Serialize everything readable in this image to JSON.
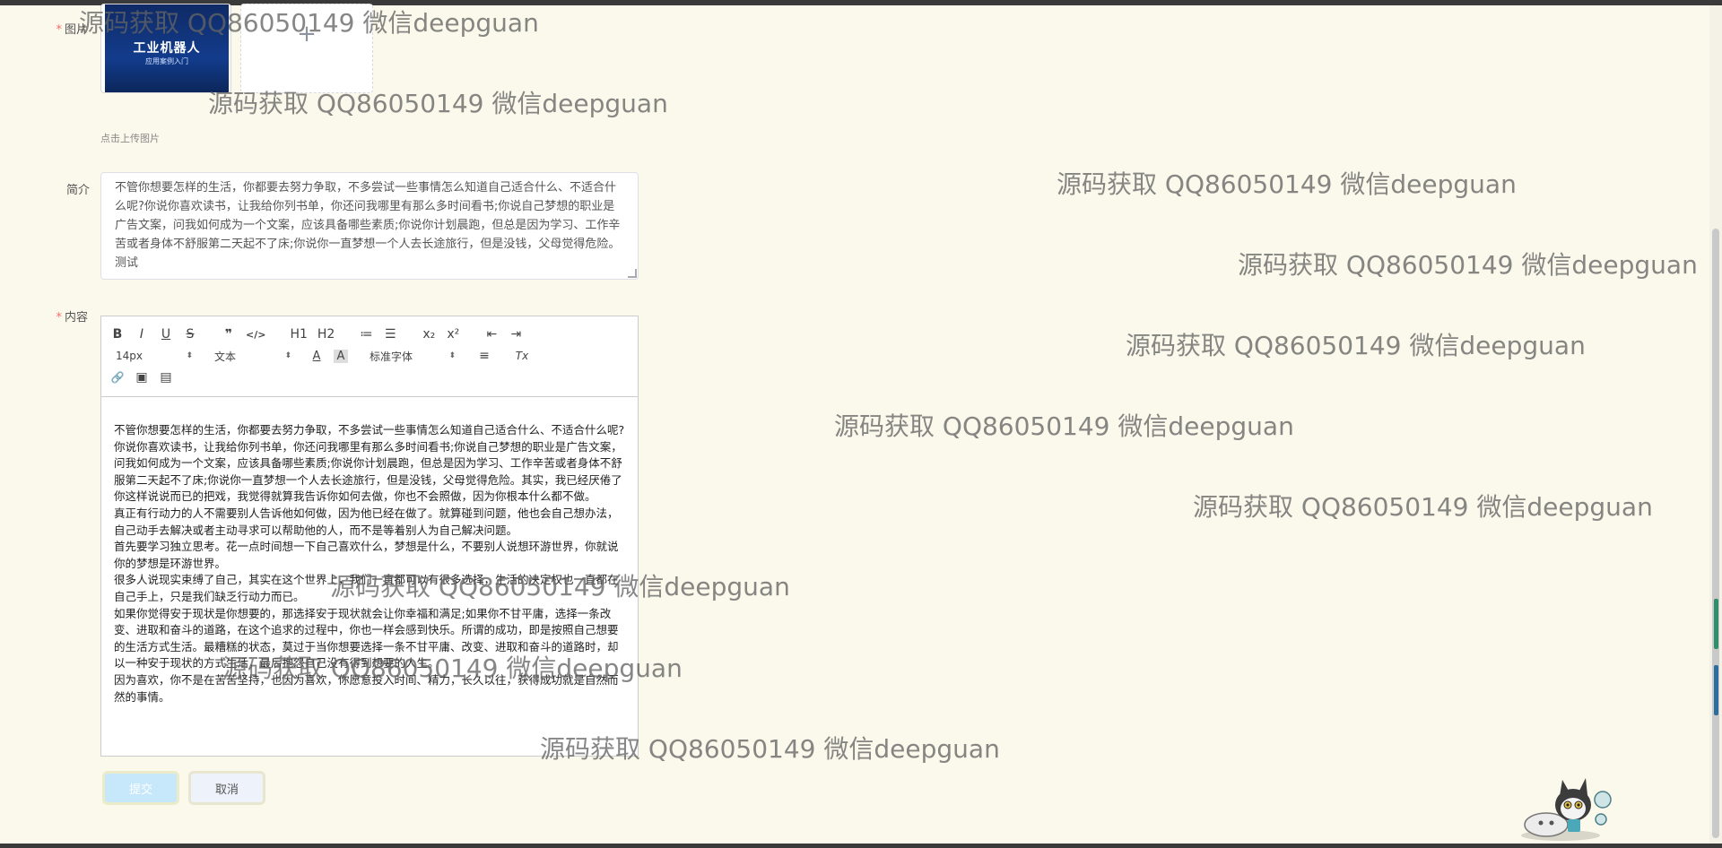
{
  "form": {
    "image_label": "图片",
    "upload_plus": "+",
    "upload_hint": "点击上传图片",
    "book_title": "工业机器人",
    "book_subtitle": "应用案例入门",
    "summary_label": "简介",
    "summary_value": "不管你想要怎样的生活，你都要去努力争取，不多尝试一些事情怎么知道自己适合什么、不适合什么呢?你说你喜欢读书，让我给你列书单，你还问我哪里有那么多时间看书;你说自己梦想的职业是广告文案，问我如何成为一个文案，应该具备哪些素质;你说你计划晨跑，但总是因为学习、工作辛苦或者身体不舒服第二天起不了床;你说你一直梦想一个人去长途旅行，但是没钱，父母觉得危险。测试",
    "content_label": "内容",
    "required_mark": "*",
    "submit_label": "提交",
    "cancel_label": "取消"
  },
  "editor": {
    "toolbar": {
      "bold": "B",
      "italic": "I",
      "underline": "U",
      "strike": "S",
      "blockquote": "❞",
      "code": "</>",
      "h1": "H1",
      "h2": "H2",
      "ordered_list": "≔",
      "bullet_list": "☰",
      "subscript": "x₂",
      "superscript": "x²",
      "outdent": "⇤",
      "indent": "⇥",
      "size": "14px",
      "header": "文本",
      "color": "A",
      "background": "A",
      "font": "标准字体",
      "align": "≡",
      "clean": "Tx",
      "link": "🔗",
      "image": "▣",
      "video": "▤",
      "select_arrow": "⬍"
    },
    "paragraphs": [
      "不管你想要怎样的生活，你都要去努力争取，不多尝试一些事情怎么知道自己适合什么、不适合什么呢?",
      "你说你喜欢读书，让我给你列书单，你还问我哪里有那么多时间看书;你说自己梦想的职业是广告文案，问我如何成为一个文案，应该具备哪些素质;你说你计划晨跑，但总是因为学习、工作辛苦或者身体不舒服第二天起不了床;你说你一直梦想一个人去长途旅行，但是没钱，父母觉得危险。其实，我已经厌倦了你这样说说而已的把戏，我觉得就算我告诉你如何去做，你也不会照做，因为你根本什么都不做。",
      "真正有行动力的人不需要别人告诉他如何做，因为他已经在做了。就算碰到问题，他也会自己想办法，自己动手去解决或者主动寻求可以帮助他的人，而不是等着别人为自己解决问题。",
      "首先要学习独立思考。花一点时间想一下自己喜欢什么，梦想是什么，不要别人说想环游世界，你就说你的梦想是环游世界。",
      "很多人说现实束缚了自己，其实在这个世界上，我们一直都可以有很多选择，生活的决定权也一直都在自己手上，只是我们缺乏行动力而已。",
      "如果你觉得安于现状是你想要的，那选择安于现状就会让你幸福和满足;如果你不甘平庸，选择一条改变、进取和奋斗的道路，在这个追求的过程中，你也一样会感到快乐。所谓的成功，即是按照自己想要的生活方式生活。最糟糕的状态，莫过于当你想要选择一条不甘平庸、改变、进取和奋斗的道路时，却以一种安于现状的方式生活，最后抱怨自己没有得到想要的人生。",
      "因为喜欢，你不是在苦苦坚持，也因为喜欢，你愿意投入时间、精力，长久以往，获得成功就是自然而然的事情。"
    ]
  },
  "watermark": {
    "text": "源码获取 QQ86050149 微信deepguan"
  }
}
